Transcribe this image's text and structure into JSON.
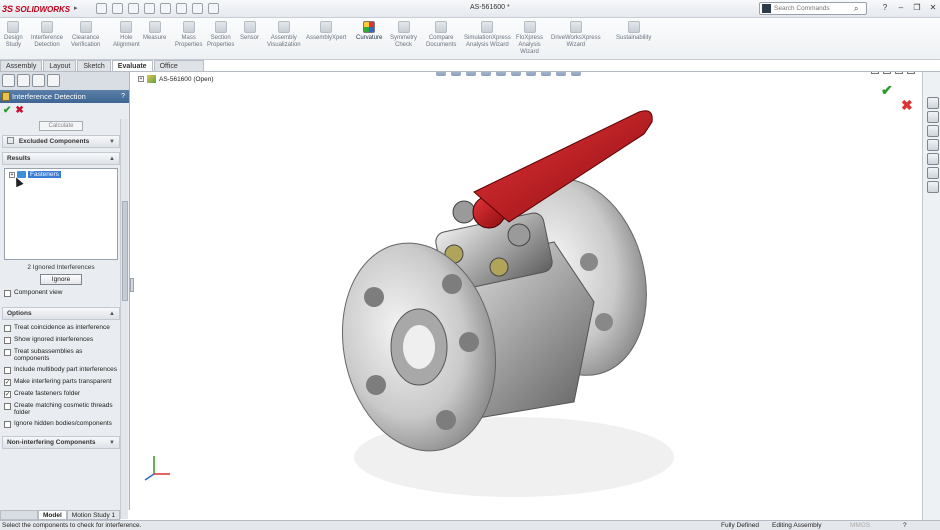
{
  "app": {
    "logo_text": "SOLIDWORKS",
    "logo_ds": "3S",
    "doc_title": "AS-561600 *"
  },
  "search": {
    "placeholder": "Search Commands"
  },
  "ribbon": [
    {
      "label": "Design\nStudy"
    },
    {
      "label": "Interference\nDetection"
    },
    {
      "label": "Clearance\nVerification"
    },
    {
      "label": "Hole\nAlignment"
    },
    {
      "label": "Measure"
    },
    {
      "label": "Mass\nProperties"
    },
    {
      "label": "Section\nProperties"
    },
    {
      "label": "Sensor"
    },
    {
      "label": "Assembly\nVisualization"
    },
    {
      "label": "AssemblyXpert"
    },
    {
      "label": "Curvature"
    },
    {
      "label": "Symmetry\nCheck"
    },
    {
      "label": "Compare\nDocuments"
    },
    {
      "label": "SimulationXpress\nAnalysis Wizard"
    },
    {
      "label": "FloXpress\nAnalysis\nWizard"
    },
    {
      "label": "DriveWorksXpress\nWizard"
    },
    {
      "label": "Sustainability"
    }
  ],
  "tabs": [
    "Assembly",
    "Layout",
    "Sketch",
    "Evaluate",
    "Office Products"
  ],
  "active_tab": "Evaluate",
  "panel": {
    "title": "Interference Detection",
    "calculate": "Calculate",
    "excluded": "Excluded Components",
    "results": "Results",
    "tree_item": "Fasteners",
    "ignored_note": "2 Ignored Interferences",
    "ignore_btn": "Ignore",
    "component_view": "Component view",
    "options": "Options",
    "option_items": [
      {
        "label": "Treat coincidence as interference",
        "checked": false
      },
      {
        "label": "Show ignored interferences",
        "checked": false
      },
      {
        "label": "Treat subassemblies as components",
        "checked": false
      },
      {
        "label": "Include multibody part interferences",
        "checked": false
      },
      {
        "label": "Make interfering parts transparent",
        "checked": true
      },
      {
        "label": "Create fasteners folder",
        "checked": true
      },
      {
        "label": "Create matching cosmetic threads folder",
        "checked": false
      },
      {
        "label": "Ignore hidden bodies/components",
        "checked": false
      }
    ],
    "non_interfering": "Non-interfering Components"
  },
  "viewport": {
    "tree_label": "AS-561600  (Open)"
  },
  "bottom_tabs": [
    "Model",
    "Motion Study 1"
  ],
  "status": {
    "message": "Select the components to check for interference.",
    "defined": "Fully Defined",
    "mode": "Editing Assembly",
    "units": "MMGS",
    "help": "?"
  },
  "colors": {
    "handle": "#c0141c",
    "title_red": "#c2001a",
    "header_blue": "#3e6593"
  }
}
